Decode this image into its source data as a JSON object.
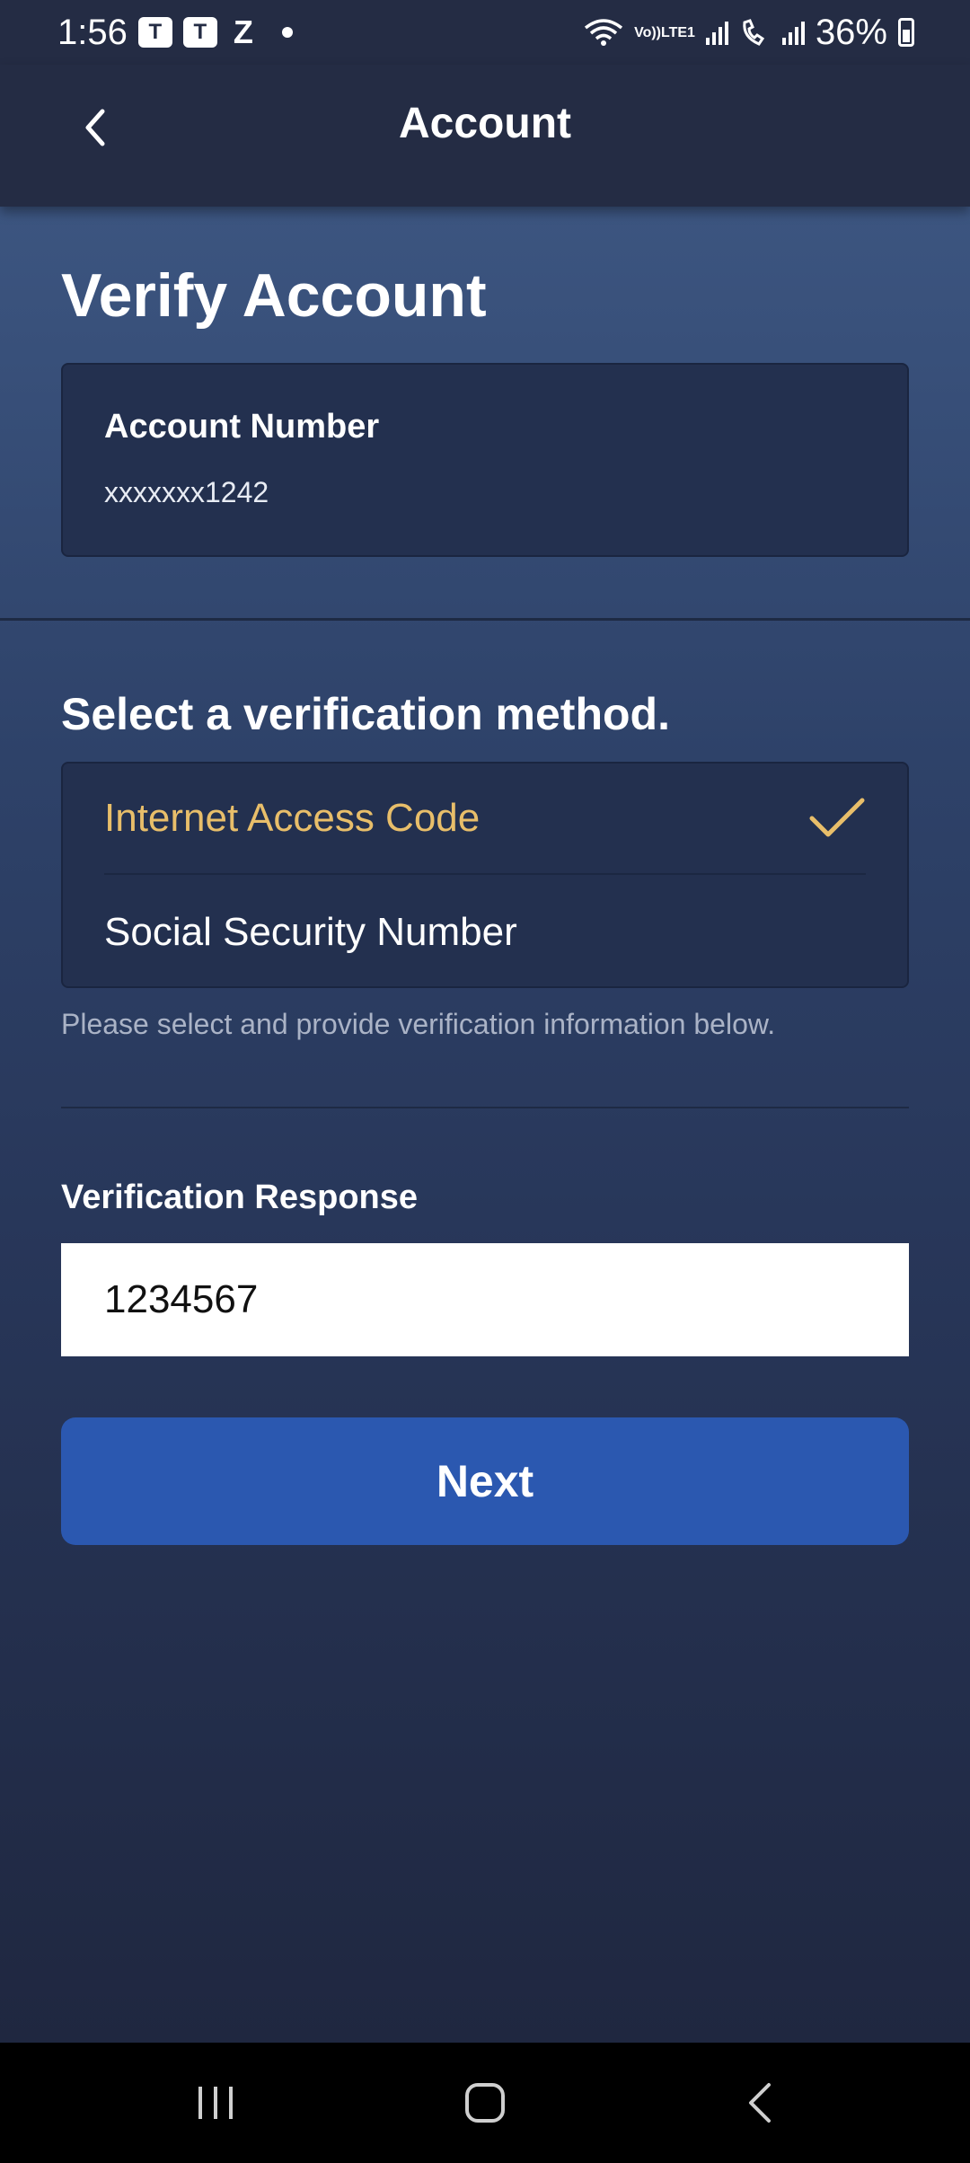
{
  "status_bar": {
    "time": "1:56",
    "app_icon_letter": "T",
    "z_label": "Z",
    "lte_label_top": "Vo))",
    "lte_label_bottom": "LTE1",
    "battery": "36%"
  },
  "header": {
    "title": "Account",
    "back_icon": "chevron-left-icon"
  },
  "page": {
    "title": "Verify Account"
  },
  "account_card": {
    "label": "Account Number",
    "value": "xxxxxxx1242"
  },
  "verification": {
    "heading": "Select a verification method.",
    "options": [
      {
        "label": "Internet Access Code",
        "selected": true
      },
      {
        "label": "Social Security Number",
        "selected": false
      }
    ],
    "helper": "Please select and provide verification information below.",
    "selected_color": "#e8be6a"
  },
  "response": {
    "label": "Verification Response",
    "value": "1234567"
  },
  "actions": {
    "next_label": "Next",
    "next_color": "#2b58b0"
  },
  "nav": {
    "recents_icon": "recents-icon",
    "home_icon": "home-icon",
    "back_icon": "back-icon"
  }
}
